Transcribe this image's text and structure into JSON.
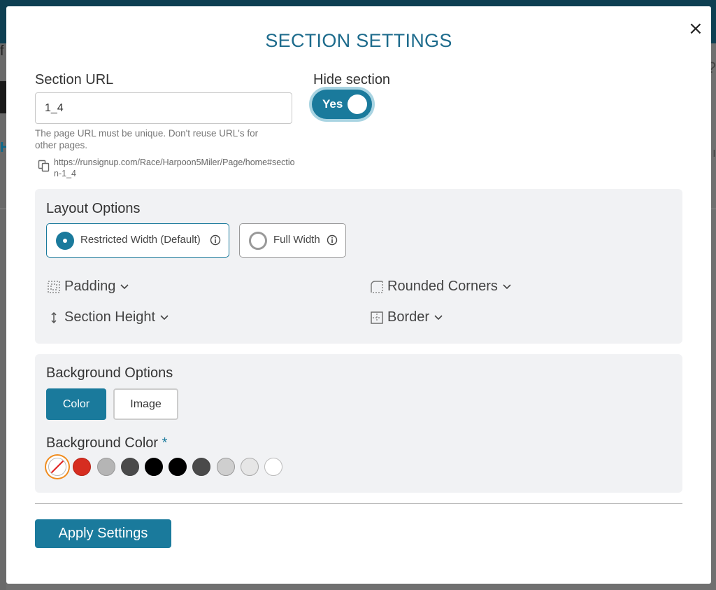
{
  "background_page": {
    "left_fragment": "f",
    "left_fragment_2": "H",
    "right_fragment": "?",
    "right_fragment_2": "ı"
  },
  "modal": {
    "title": "SECTION SETTINGS",
    "close_label": "×"
  },
  "section_url": {
    "label": "Section URL",
    "value": "1_4",
    "help": "The page URL must be unique. Don't reuse URL's for other pages.",
    "link": "https://runsignup.com/Race/Harpoon5Miler/Page/home#section-1_4",
    "copy_icon": "copy-icon"
  },
  "hide_section": {
    "label": "Hide section",
    "toggle_text": "Yes",
    "toggle_on": true
  },
  "layout_options": {
    "heading": "Layout Options",
    "width_options": [
      {
        "label": "Restricted Width (Default)",
        "selected": true,
        "icon": "info-icon"
      },
      {
        "label": "Full Width",
        "selected": false,
        "icon": "info-icon"
      }
    ],
    "settings": [
      {
        "label": "Padding",
        "icon": "padding-icon"
      },
      {
        "label": "Rounded Corners",
        "icon": "rounded-corners-icon"
      },
      {
        "label": "Section Height",
        "icon": "vertical-arrows-icon"
      },
      {
        "label": "Border",
        "icon": "border-icon"
      }
    ]
  },
  "background_options": {
    "heading": "Background Options",
    "tabs": [
      {
        "label": "Color",
        "active": true
      },
      {
        "label": "Image",
        "active": false
      }
    ],
    "color_label": "Background Color",
    "required_mark": "*",
    "swatches": [
      {
        "color": "none",
        "selected": true
      },
      {
        "color": "#d62d20",
        "selected": false
      },
      {
        "color": "#b5b5b5",
        "selected": false
      },
      {
        "color": "#4a4a4a",
        "selected": false
      },
      {
        "color": "#000000",
        "selected": false
      },
      {
        "color": "#000000",
        "selected": false
      },
      {
        "color": "#4a4a4a",
        "selected": false
      },
      {
        "color": "#cfcfcf",
        "selected": false
      },
      {
        "color": "#e6e6e6",
        "selected": false
      },
      {
        "color": "#ffffff",
        "selected": false
      }
    ]
  },
  "apply_button": "Apply Settings",
  "colors": {
    "accent": "#1a7a9c",
    "title": "#1d6b8c",
    "swatch_highlight": "#f08c1e",
    "panel_bg": "#f1f2f4"
  }
}
